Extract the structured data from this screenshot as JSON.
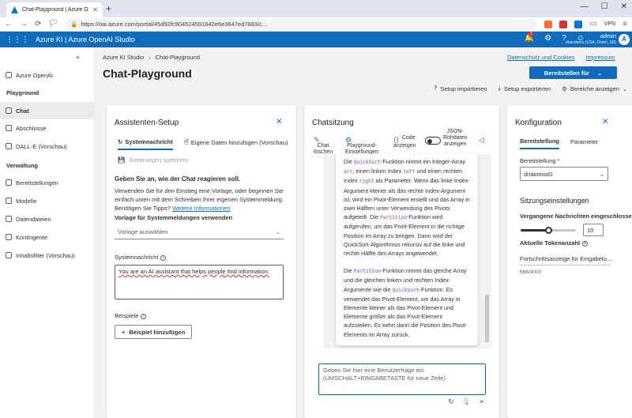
{
  "browser": {
    "tab_title": "Chat-Playground | Azure OpenAI St...",
    "url": "https://oai.azure.com/portal/45d92fc904524591842e6e3847ed7683/c...",
    "vpn_label": "VPN",
    "newtab_label": "+"
  },
  "header": {
    "brand": "Azure KI | Azure OpenAI Studio",
    "notification_count": "1",
    "user_name": "admin",
    "user_subtitle": "driaodemo (USA, Osten, SB)",
    "avatar_letter": "A"
  },
  "sidebar": {
    "top_item": "Azure OpenAI",
    "section_playground": "Playground",
    "playground_items": [
      "Chat",
      "Abschlüsse",
      "DALL-E (Vorschau)"
    ],
    "section_admin": "Verwaltung",
    "admin_items": [
      "Bereitstellungen",
      "Modelle",
      "Datendateien",
      "Kontingente",
      "Inhaltsfilter (Vorschau)"
    ]
  },
  "main": {
    "breadcrumb": [
      "Azure KI Studio",
      "Chat-Playground"
    ],
    "links": [
      "Datenschutz und Cookies",
      "Impressum"
    ],
    "title": "Chat-Playground",
    "deploy_button": "Bereitstellen für",
    "actions": [
      "Setup importieren",
      "Setup exportieren",
      "Bereiche anzeigen"
    ]
  },
  "setup": {
    "title": "Assistenten-Setup",
    "tabs": [
      "Systemnachricht",
      "Eigene Daten hinzufügen (Vorschau)"
    ],
    "save_changes": "Änderungen speichern",
    "heading": "Geben Sie an, wie der Chat reagieren soll.",
    "help": "Verwenden Sie für den Einstieg eine Vorlage, oder beginnen Sie einfach unten mit dem Schreiben Ihrer eigenen Systemmeldung. Benötigen Sie Tipps?",
    "help_link": "Weitere Informationen",
    "template_label": "Vorlage für Systemmeldungen verwenden",
    "template_placeholder": "Vorlage auswählen",
    "system_message_label": "Systemnachricht",
    "system_message_value": "You are an AI assistant that helps people find information.",
    "examples_label": "Beispiele",
    "add_example_button": "Beispiel hinzufügen"
  },
  "chat": {
    "title": "Chatsitzung",
    "tools": [
      {
        "l1": "Chat",
        "l2": "löschen"
      },
      {
        "l1": "Playground-",
        "l2": "Einstellungen"
      },
      {
        "l1": "Code",
        "l2": "anzeigen"
      }
    ],
    "json_toggle": {
      "l1": "JSON-",
      "l2": "Rohdaten",
      "l3": "anzeigen"
    },
    "para1": {
      "t1": "Die ",
      "c1": "QuickSort",
      "t2": "-Funktion nimmt ein Integer-Array ",
      "c2": "arr",
      "t3": ", einen linken Index ",
      "c3": "left",
      "t4": " und einen rechten Index ",
      "c4": "right",
      "t5": " als Parameter. Wenn das linke Index-Argument kleiner als das rechte Index-Argument ist, wird ein Pivot-Element erstellt und das Array in zwei Hälften unter Verwendung des Pivots aufgeteilt. Die ",
      "c5": "Partition",
      "t6": "-Funktion wird aufgerufen, um das Pivot-Element in die richtige Position im Array zu bringen. Dann wird der QuickSort-Algorithmus rekursiv auf die linke und rechte Hälfte des Arrays angewendet."
    },
    "para2": {
      "t1": "Die ",
      "c1": "Partition",
      "t2": "-Funktion nimmt das gleiche Array und die gleichen linken und rechten Index-Argumente wie die ",
      "c2": "QuickSort",
      "t3": "-Funktion. Es verwendet das Pivot-Element, um das Array in Elemente kleiner als das Pivot-Element und Elemente größer als das Pivot-Element aufzuteilen. Es kehrt dann die Position des Pivot-Elements im Array zurück."
    },
    "input_placeholder": "Geben Sie hier eine Benutzerfrage ein. (UMSCHALT+EINGABETASTE für neue Zeile)"
  },
  "config": {
    "title": "Konfiguration",
    "tabs": [
      "Bereitstellung",
      "Parameter"
    ],
    "deployment_label": "Bereitstellung",
    "required_mark": "*",
    "deployment_value": "driaiomod1",
    "session_heading": "Sitzungseinstellungen",
    "past_messages_label": "Vergangene Nachrichten eingeschlossen",
    "past_messages_value": "10",
    "past_messages_fraction": 0.5,
    "token_label": "Aktuelle Tokenanzahl",
    "progress_text": "Fortschrittsanzeige für Eingabeto...",
    "token_count": "668/4000"
  },
  "colors": {
    "accent": "#0f6cbd"
  }
}
